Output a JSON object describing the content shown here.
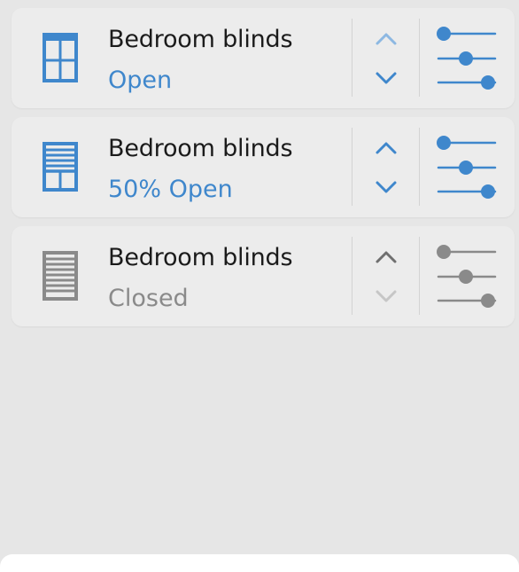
{
  "colors": {
    "active": "#3f87cc",
    "inactive": "#8a8a8a",
    "disabled_arrow": "#c6c6c6",
    "faded_active_arrow": "#8db8e2"
  },
  "blinds": [
    {
      "name": "Bedroom blinds",
      "status": "Open",
      "state": "open",
      "icon": "window-open-icon",
      "up_enabled": false,
      "down_enabled": true
    },
    {
      "name": "Bedroom blinds",
      "status": "50% Open",
      "state": "half",
      "icon": "window-half-open-icon",
      "up_enabled": true,
      "down_enabled": true
    },
    {
      "name": "Bedroom blinds",
      "status": "Closed",
      "state": "closed",
      "icon": "window-closed-icon",
      "up_enabled": true,
      "down_enabled": false
    }
  ]
}
